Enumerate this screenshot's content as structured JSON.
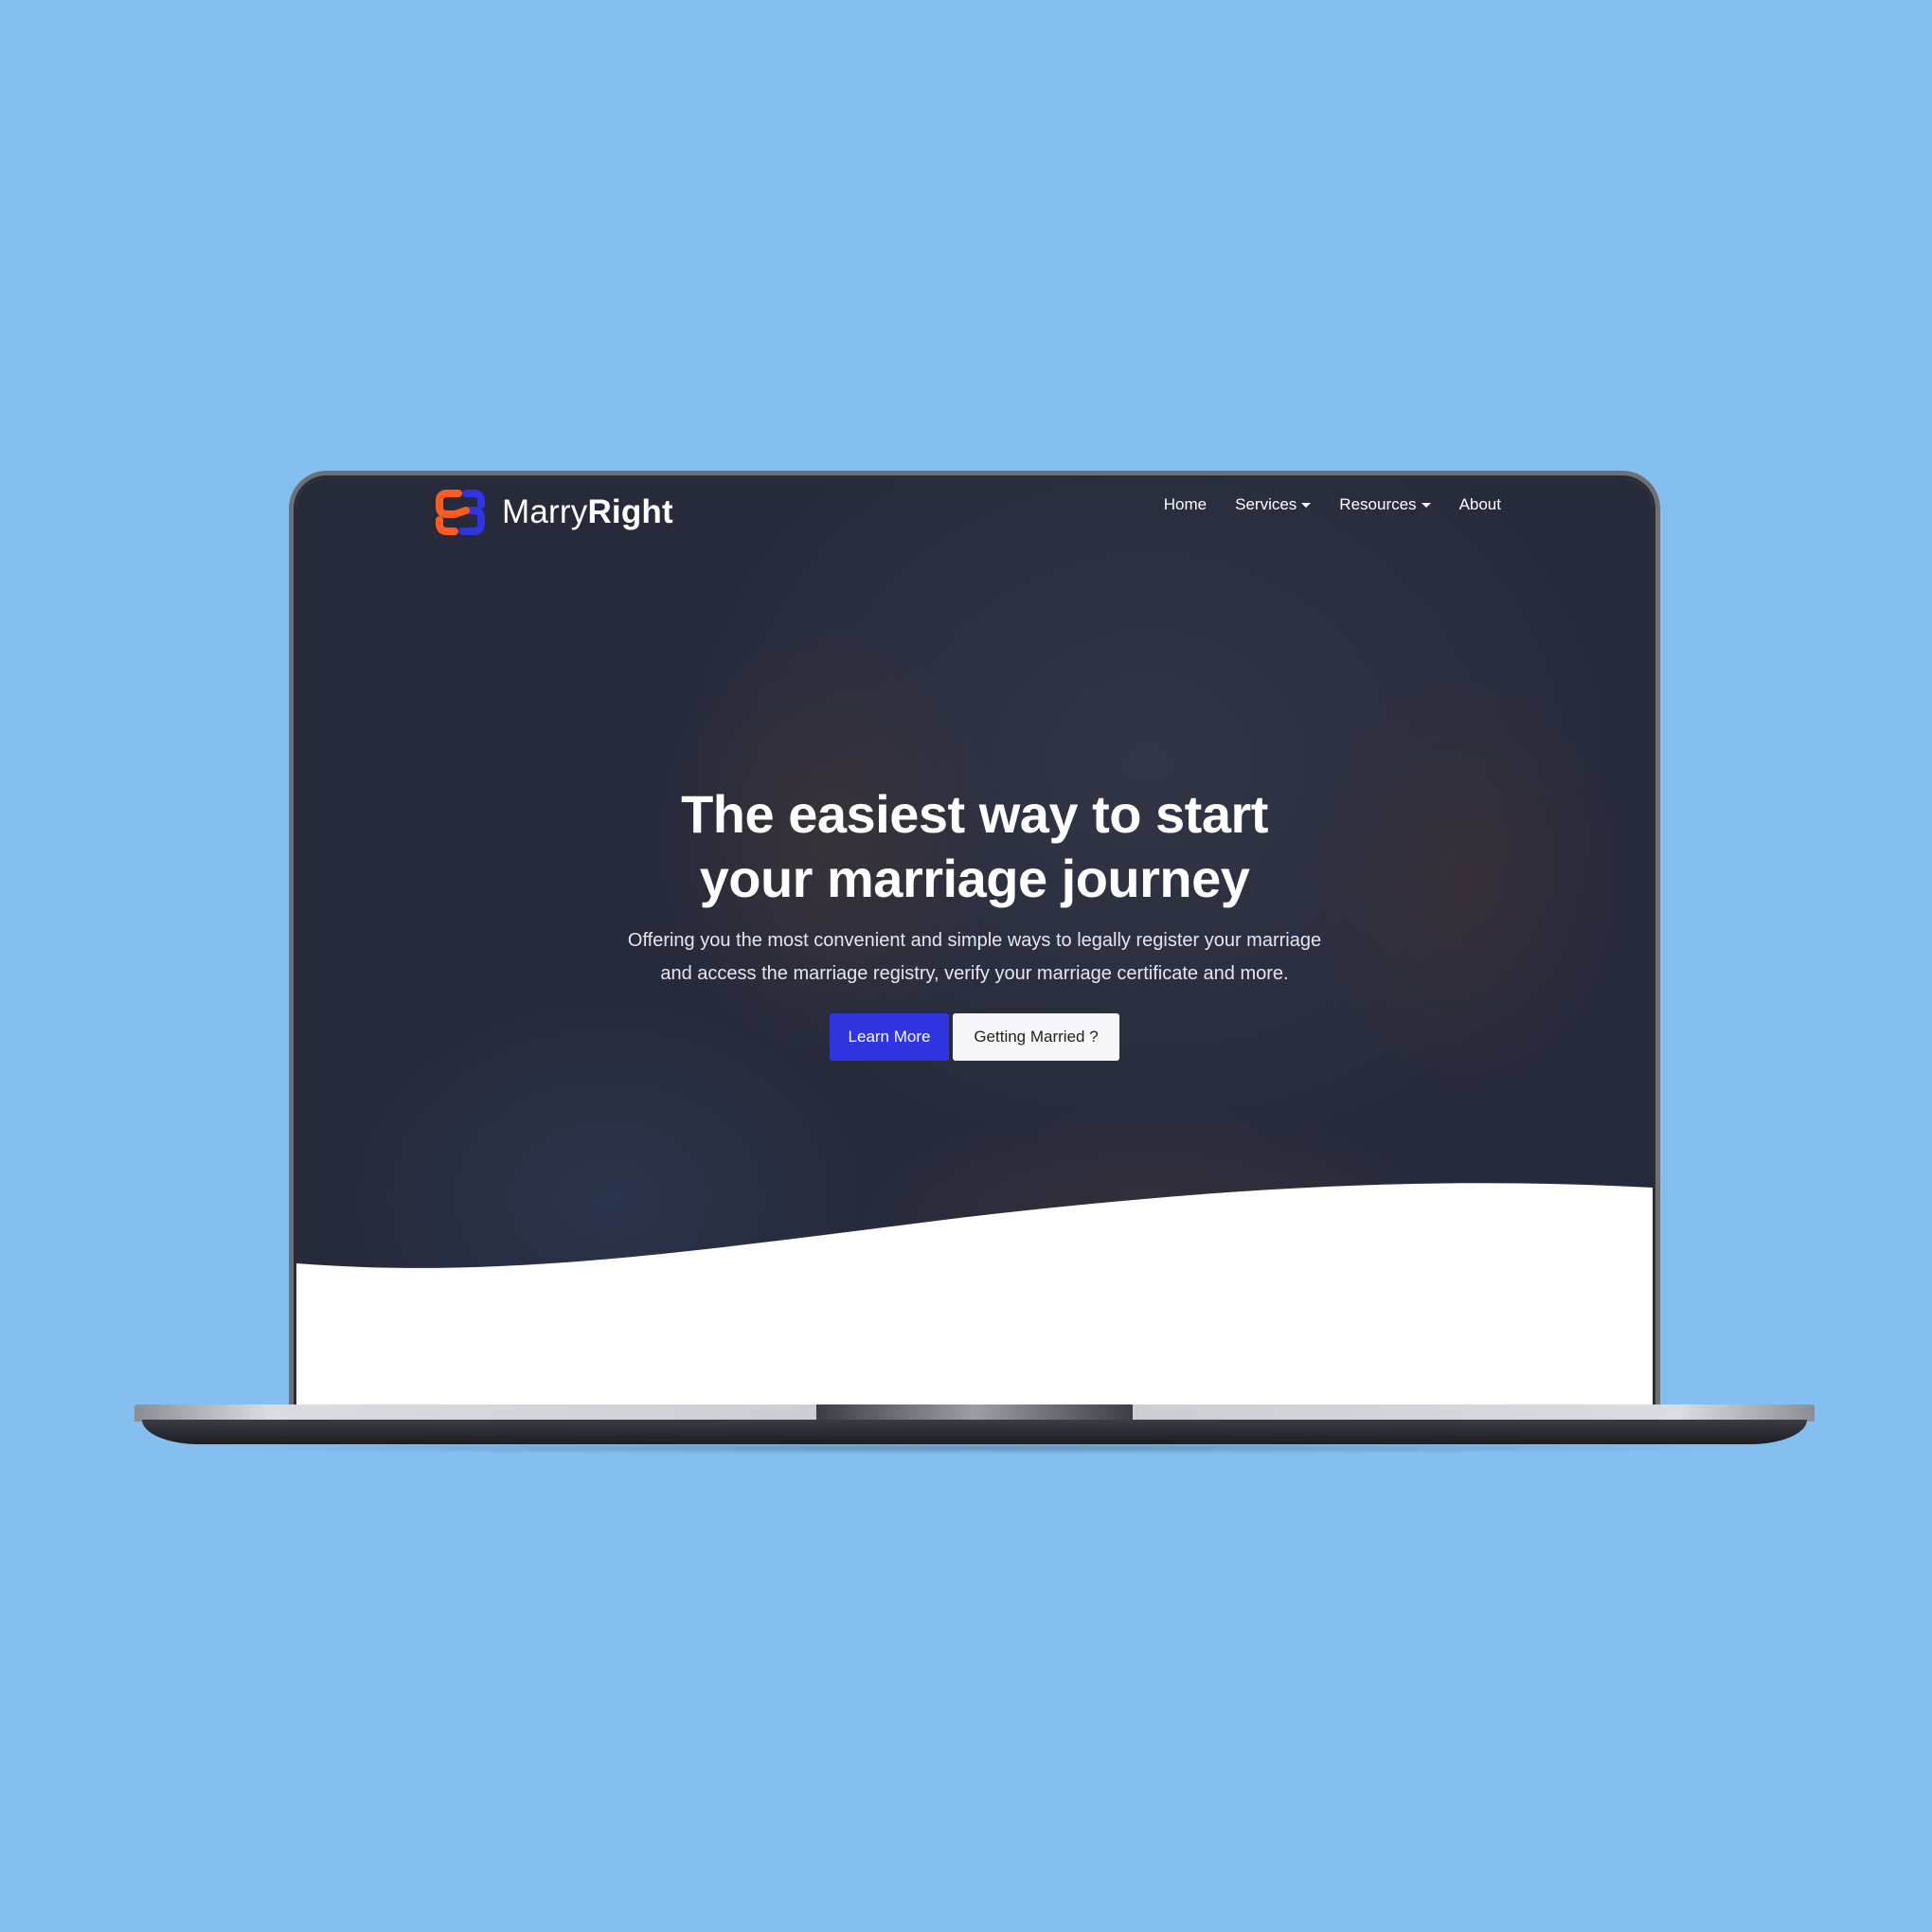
{
  "brand": {
    "name_light": "Marry",
    "name_bold": "Right",
    "logo_colors": [
      "#ff5a1f",
      "#2f35e0"
    ]
  },
  "nav": {
    "items": [
      {
        "label": "Home",
        "dropdown": false
      },
      {
        "label": "Services",
        "dropdown": true
      },
      {
        "label": "Resources",
        "dropdown": true
      },
      {
        "label": "About",
        "dropdown": false
      }
    ]
  },
  "hero": {
    "headline_line1": "The easiest way to start",
    "headline_line2": "your marriage journey",
    "subtext": "Offering you the most convenient and simple ways to legally register your marriage and access the marriage registry, verify your marriage certificate and more.",
    "primary_cta": "Learn More",
    "secondary_cta": "Getting Married ?"
  },
  "colors": {
    "background": "#84bff0",
    "primary": "#2f35e0",
    "accent": "#ff5a1f"
  }
}
